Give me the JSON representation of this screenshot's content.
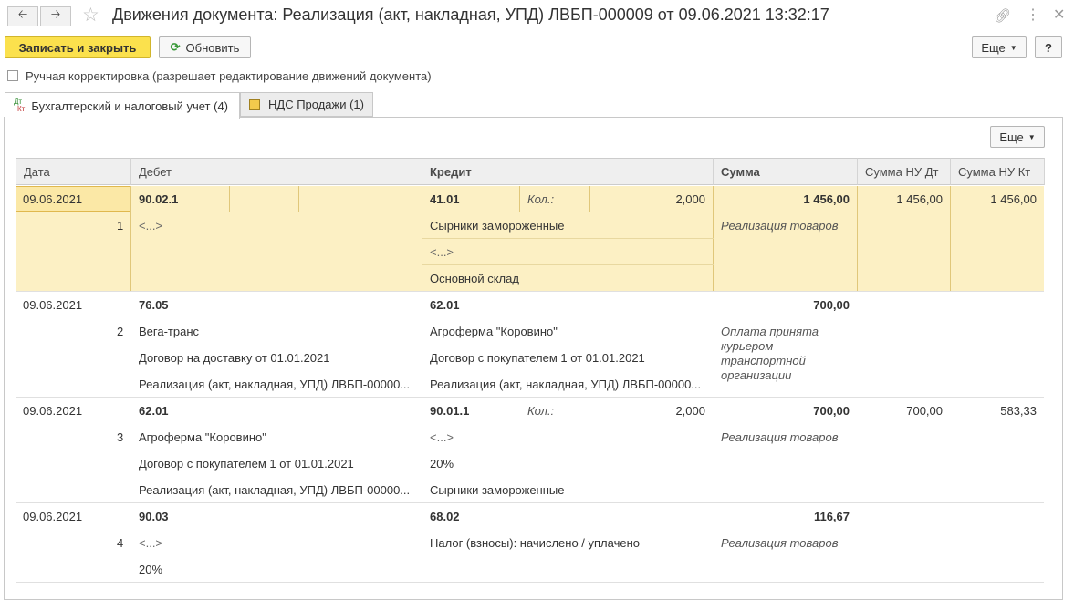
{
  "window": {
    "title": "Движения документа: Реализация (акт, накладная, УПД) ЛВБП-000009 от 09.06.2021 13:32:17",
    "back_icon": "arrow-left-icon",
    "forward_icon": "arrow-right-icon",
    "favorite_icon": "star-icon",
    "link_icon": "link-icon",
    "menu_icon": "more-vertical-icon",
    "close_icon": "close-icon"
  },
  "toolbar": {
    "save_close_label": "Записать и закрыть",
    "refresh_label": "Обновить",
    "more_label": "Еще",
    "help_label": "?"
  },
  "manual_edit": {
    "label": "Ручная корректировка (разрешает редактирование движений документа)",
    "checked": false
  },
  "tabs": [
    {
      "label": "Бухгалтерский и налоговый учет (4)",
      "active": true,
      "icon": "dt-kt-icon"
    },
    {
      "label": "НДС Продажи (1)",
      "active": false,
      "icon": "register-icon"
    }
  ],
  "panel": {
    "more_label": "Еще"
  },
  "table": {
    "columns": [
      "Дата",
      "Дебет",
      "Кредит",
      "Сумма",
      "Сумма НУ Дт",
      "Сумма НУ Кт"
    ],
    "rows": [
      {
        "date": "09.06.2021",
        "num": "1",
        "debit_account": "90.02.1",
        "debit_lines": [
          "<...>"
        ],
        "credit_account": "41.01",
        "credit_qty_label": "Кол.:",
        "credit_qty": "2,000",
        "credit_lines": [
          "Сырники замороженные",
          "<...>",
          "Основной склад"
        ],
        "sum": "1 456,00",
        "sum_note": "Реализация товаров",
        "nu_dt": "1 456,00",
        "nu_kt": "1 456,00"
      },
      {
        "date": "09.06.2021",
        "num": "2",
        "debit_account": "76.05",
        "debit_lines": [
          "Вега-транс",
          "Договор на доставку от 01.01.2021",
          "Реализация (акт, накладная, УПД) ЛВБП-00000..."
        ],
        "credit_account": "62.01",
        "credit_lines": [
          "Агроферма \"Коровино\"",
          "Договор с покупателем 1 от 01.01.2021",
          "Реализация (акт, накладная, УПД) ЛВБП-00000..."
        ],
        "sum": "700,00",
        "sum_note": "Оплата принята курьером транспортной организации",
        "nu_dt": "",
        "nu_kt": ""
      },
      {
        "date": "09.06.2021",
        "num": "3",
        "debit_account": "62.01",
        "debit_lines": [
          "Агроферма \"Коровино\"",
          "Договор с покупателем 1 от 01.01.2021",
          "Реализация (акт, накладная, УПД) ЛВБП-00000..."
        ],
        "credit_account": "90.01.1",
        "credit_qty_label": "Кол.:",
        "credit_qty": "2,000",
        "credit_lines": [
          "<...>",
          "20%",
          "Сырники замороженные"
        ],
        "sum": "700,00",
        "sum_note": "Реализация товаров",
        "nu_dt": "700,00",
        "nu_kt": "583,33"
      },
      {
        "date": "09.06.2021",
        "num": "4",
        "debit_account": "90.03",
        "debit_lines": [
          "<...>",
          "20%"
        ],
        "credit_account": "68.02",
        "credit_lines": [
          "Налог (взносы): начислено / уплачено"
        ],
        "sum": "116,67",
        "sum_note": "Реализация товаров",
        "nu_dt": "",
        "nu_kt": ""
      }
    ]
  }
}
